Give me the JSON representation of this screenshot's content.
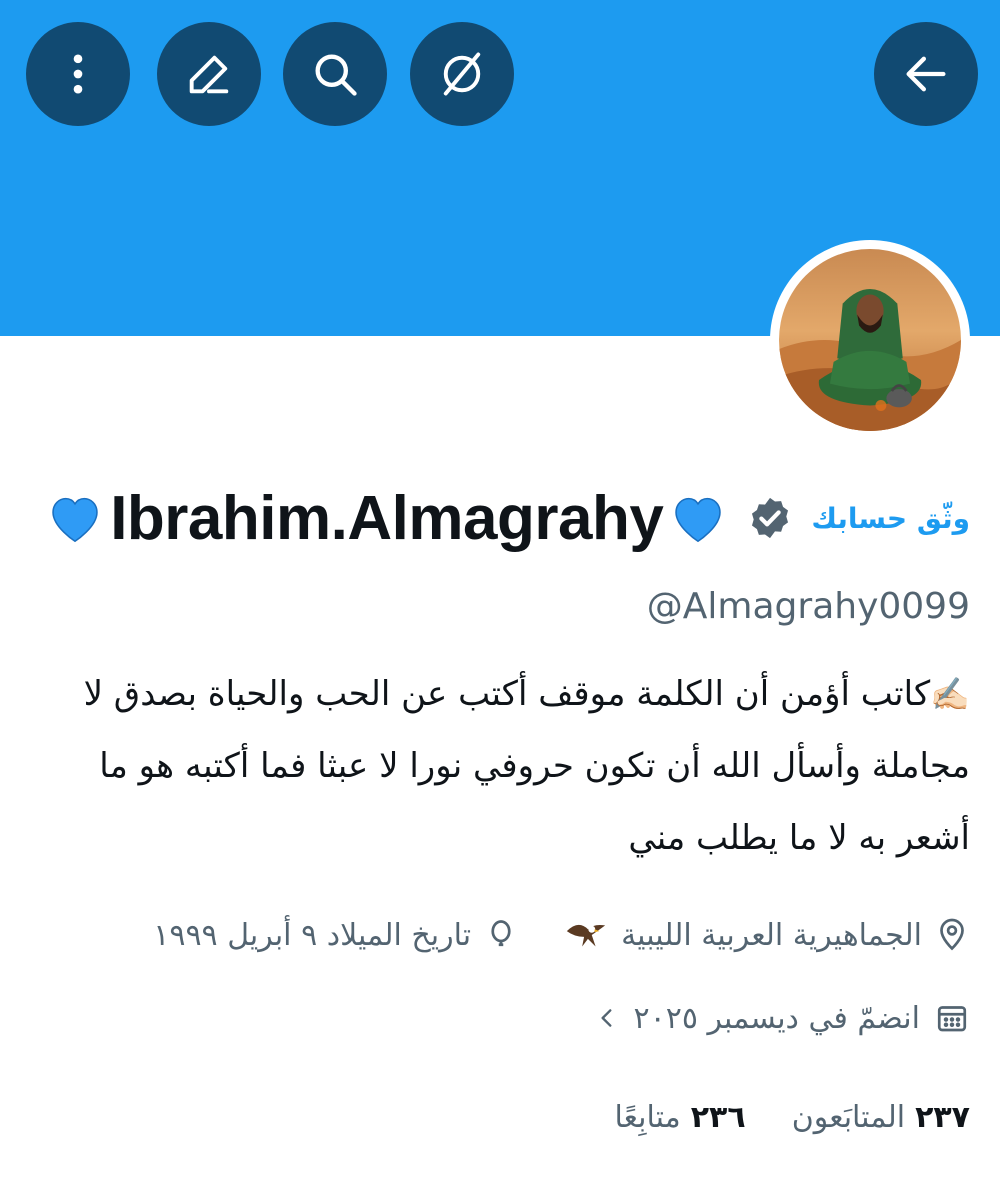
{
  "header": {
    "back_icon": "arrow-left-icon",
    "actions": [
      "more-vertical-icon",
      "edit-icon",
      "search-icon",
      "hide-icon"
    ],
    "banner_color": "#1d9bf0",
    "button_color": "#114a72"
  },
  "profile": {
    "verify_cta": "وثّق حسابك",
    "display_name": "Ibrahim.Almagrahy",
    "name_emoji": "blue-heart",
    "handle": "@Almagrahy0099",
    "bio": "كاتب أؤمن أن الكلمة موقف أكتب عن الحب والحياة بصدق لا مجاملة وأسأل الله أن تكون حروفي نورا لا عبثا فما أكتبه هو ما أشعر به لا ما يطلب مني",
    "bio_emoji": "✍🏻",
    "location": "الجماهيرية العربية الليبية",
    "location_emoji": "eagle",
    "birthday": "تاريخ الميلاد ٩ أبريل ١٩٩٩",
    "joined": "انضمّ في ديسمبر ٢٠٢٥"
  },
  "stats": {
    "followers_count": "٢٣٧",
    "followers_label": "المتابَعون",
    "following_count": "٢٣٦",
    "following_label": "متابِعًا"
  },
  "colors": {
    "accent": "#1d9bf0",
    "secondary_text": "#536471",
    "primary_text": "#0f1419"
  }
}
